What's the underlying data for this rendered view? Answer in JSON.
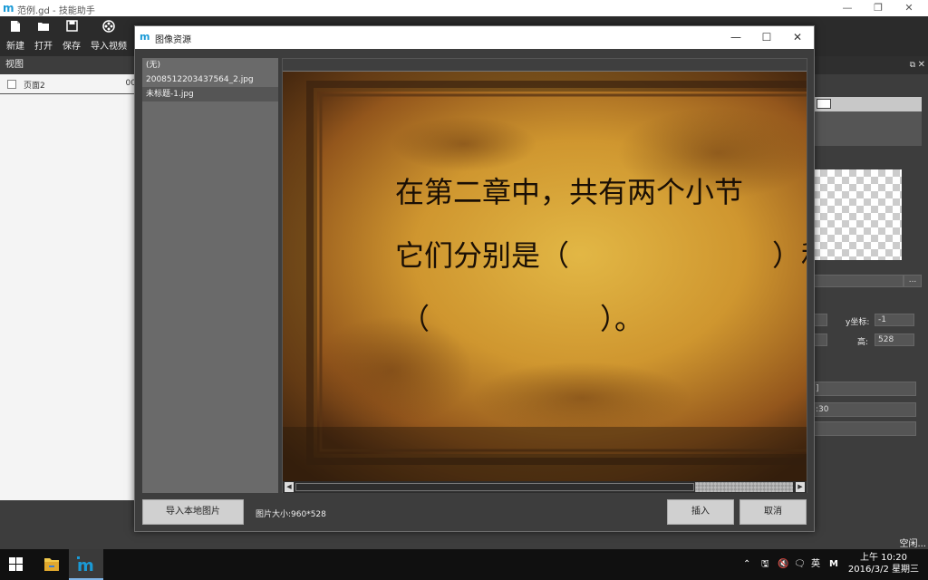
{
  "app": {
    "logo": "m",
    "title": "范例.gd  - 技能助手",
    "window_buttons": {
      "minimize": "—",
      "maximize": "❐",
      "close": "✕"
    }
  },
  "toolbar": {
    "buttons": [
      {
        "label": "新建",
        "icon": "new-file-icon"
      },
      {
        "label": "打开",
        "icon": "folder-open-icon"
      },
      {
        "label": "保存",
        "icon": "save-icon"
      },
      {
        "label": "导入视频",
        "icon": "film-reel-icon"
      }
    ]
  },
  "left_panel": {
    "title": "视图",
    "pages": [
      {
        "name": "页面2",
        "num": "00"
      }
    ]
  },
  "right_panel": {
    "pin": "⧉",
    "close": "✕",
    "y_label": "y坐标:",
    "y_value": "-1",
    "h_label": "高:",
    "h_value": "528",
    "time_partial": ":30",
    "field_partial": "]",
    "browse": "..."
  },
  "status": {
    "text": "空闲..."
  },
  "dialog": {
    "title": "图像资源",
    "logo": "m",
    "buttons": {
      "minimize": "—",
      "maximize": "☐",
      "close": "✕"
    },
    "files": [
      {
        "name": "(无)",
        "selected": false
      },
      {
        "name": "2008512203437564_2.jpg",
        "selected": false
      },
      {
        "name": "未标题-1.jpg",
        "selected": true
      }
    ],
    "image_text": {
      "line1": "在第二章中，共有两个小节",
      "line2": "它们分别是（",
      "line2b": "）和",
      "line3a": "（",
      "line3b": "）。"
    },
    "import_button": "导入本地图片",
    "size_info": "图片大小:960*528",
    "insert_button": "插入",
    "cancel_button": "取消"
  },
  "taskbar": {
    "tray_items": [
      "⌃",
      "🖫",
      "🔇",
      "🗨",
      "英",
      "M"
    ],
    "time": "上午 10:20",
    "date": "2016/3/2 星期三"
  }
}
